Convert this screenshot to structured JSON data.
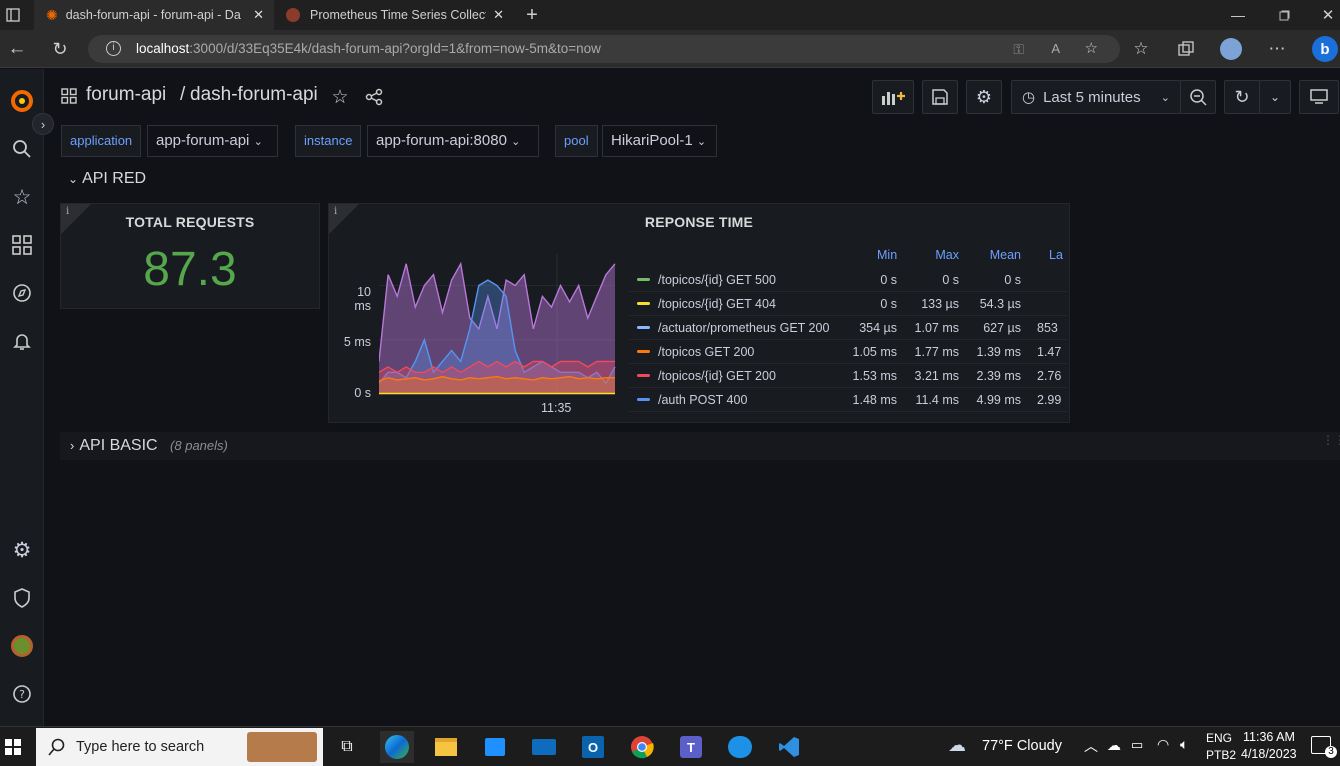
{
  "browser": {
    "tabs": [
      {
        "title": "dash-forum-api - forum-api - Da",
        "active": true
      },
      {
        "title": "Prometheus Time Series Collectio",
        "active": false
      }
    ],
    "url_host": "localhost",
    "url_rest": ":3000/d/33Eq35E4k/dash-forum-api?orgId=1&from=now-5m&to=now"
  },
  "dashboard": {
    "folder": "forum-api",
    "separator": "/",
    "name": "dash-forum-api",
    "time_range": "Last 5 minutes"
  },
  "variables": [
    {
      "label": "application",
      "value": "app-forum-api"
    },
    {
      "label": "instance",
      "value": "app-forum-api:8080"
    },
    {
      "label": "pool",
      "value": "HikariPool-1"
    }
  ],
  "rows": {
    "api_red": {
      "title": "API RED"
    },
    "api_basic": {
      "title": "API BASIC",
      "note": "(8 panels)"
    }
  },
  "panels": {
    "total_requests": {
      "title": "TOTAL REQUESTS",
      "value": "87.3",
      "color": "#56a64b"
    },
    "response_time": {
      "title": "REPONSE TIME",
      "y_ticks": [
        "10 ms",
        "5 ms",
        "0 s"
      ],
      "x_tick": "11:35",
      "legend_headers": [
        "Min",
        "Max",
        "Mean",
        "La"
      ],
      "legend": [
        {
          "name": "/topicos/{id} GET 500",
          "color": "#73bf69",
          "min": "0 s",
          "max": "0 s",
          "mean": "0 s",
          "last": ""
        },
        {
          "name": "/topicos/{id} GET 404",
          "color": "#fade2a",
          "min": "0 s",
          "max": "133 µs",
          "mean": "54.3 µs",
          "last": ""
        },
        {
          "name": "/actuator/prometheus GET 200",
          "color": "#8ab8ff",
          "min": "354 µs",
          "max": "1.07 ms",
          "mean": "627 µs",
          "last": "853"
        },
        {
          "name": "/topicos GET 200",
          "color": "#ff780a",
          "min": "1.05 ms",
          "max": "1.77 ms",
          "mean": "1.39 ms",
          "last": "1.47"
        },
        {
          "name": "/topicos/{id} GET 200",
          "color": "#f2495c",
          "min": "1.53 ms",
          "max": "3.21 ms",
          "mean": "2.39 ms",
          "last": "2.76"
        },
        {
          "name": "/auth POST 400",
          "color": "#5794f2",
          "min": "1.48 ms",
          "max": "11.4 ms",
          "mean": "4.99 ms",
          "last": "2.99"
        }
      ]
    }
  },
  "chart_data": {
    "type": "area",
    "x_tick_labels": [
      "11:35"
    ],
    "ylim": [
      0,
      12
    ],
    "y_unit": "ms",
    "series": [
      {
        "name": "/auth POST 400",
        "color": "#b877d9",
        "values": [
          3,
          11,
          9,
          12,
          8,
          10,
          11,
          7.5,
          10.5,
          12,
          7,
          6,
          9,
          6,
          10.5,
          10,
          11,
          6,
          9,
          8,
          10,
          8.5,
          10,
          7,
          9,
          11,
          12
        ]
      },
      {
        "name": "/actuator/prometheus GET 200",
        "color": "#5794f2",
        "values": [
          1,
          2,
          2,
          1.5,
          3,
          5,
          2,
          3,
          4,
          3,
          6,
          10,
          10.5,
          10,
          9,
          4,
          2,
          2.5,
          3,
          2.5,
          2,
          2,
          2,
          1.5,
          2,
          1,
          2.5
        ]
      },
      {
        "name": "/topicos/{id} GET 200",
        "color": "#f2495c",
        "values": [
          2,
          2.5,
          2,
          2.5,
          2,
          2,
          2.5,
          2,
          2.5,
          2,
          2.5,
          3,
          2.5,
          3,
          2.5,
          3,
          2.5,
          3,
          3,
          2.5,
          3,
          3,
          3,
          2.5,
          3,
          3,
          3
        ]
      },
      {
        "name": "/topicos GET 200",
        "color": "#ff780a",
        "values": [
          1.2,
          1.5,
          1.3,
          1.4,
          1.5,
          1.3,
          1.4,
          1.6,
          1.4,
          1.3,
          1.5,
          1.4,
          1.5,
          1.6,
          1.4,
          1.5,
          1.4,
          1.3,
          1.5,
          1.4,
          1.5,
          1.6,
          1.4,
          1.5,
          1.4,
          1.5,
          1.5
        ]
      }
    ]
  },
  "taskbar": {
    "search_placeholder": "Type here to search",
    "weather": "77°F  Cloudy",
    "lang1": "ENG",
    "lang2": "PTB2",
    "time": "11:36 AM",
    "date": "4/18/2023",
    "notifications": "3"
  }
}
